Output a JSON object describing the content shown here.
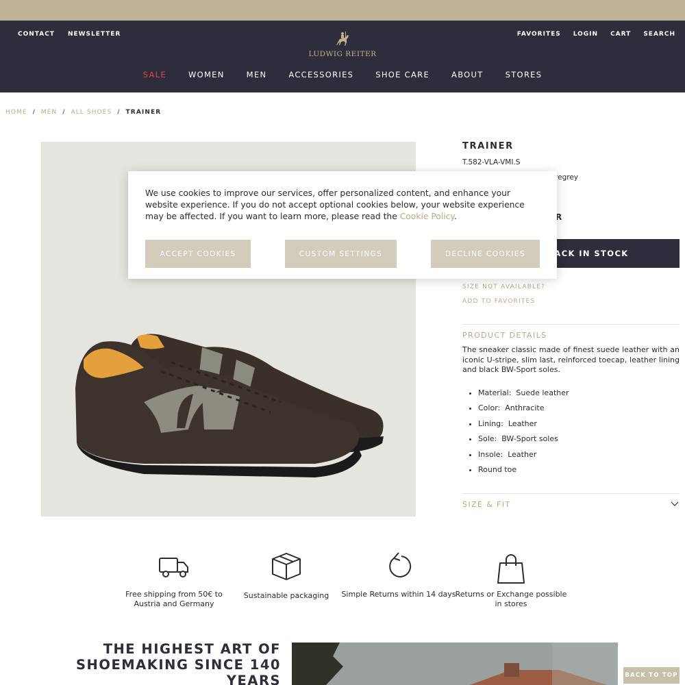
{
  "header": {
    "left_links": [
      "CONTACT",
      "NEWSLETTER"
    ],
    "right_links": [
      "FAVORITES",
      "LOGIN",
      "CART",
      "SEARCH"
    ],
    "logo_text": "LUDWIG REITER",
    "nav": [
      "SALE",
      "WOMEN",
      "MEN",
      "ACCESSORIES",
      "SHOE CARE",
      "ABOUT",
      "STORES"
    ]
  },
  "breadcrumb": {
    "items": [
      "HOME",
      "MEN",
      "ALL SHOES"
    ],
    "current": "TRAINER",
    "separator": "/"
  },
  "product": {
    "title": "TRAINER",
    "sku": "T.582-VLA-VMI.S",
    "color_fragment": "ivegrey",
    "price_fragment": "R",
    "notify_button": "ACK IN STOCK",
    "size_not_available": "SIZE NOT AVAILABLE?",
    "add_to_favorites": "ADD TO FAVORITES",
    "details_title": "PRODUCT DETAILS",
    "description": "The sneaker classic made of finest suede leather with an iconic U-stripe, slim last, reinforced toecap, leather lining and black BW-Sport soles.",
    "details": [
      {
        "label": "Material:",
        "value": "Suede leather"
      },
      {
        "label": "Color:",
        "value": "Anthracite"
      },
      {
        "label": "Lining:",
        "value": "Leather"
      },
      {
        "label": "Sole:",
        "value": "BW-Sport soles"
      },
      {
        "label": "Insole:",
        "value": "Leather"
      },
      {
        "label": "",
        "value": "Round toe"
      }
    ],
    "size_fit_title": "SIZE & FIT"
  },
  "features": [
    {
      "icon": "truck-icon",
      "label": "Free shipping from 50€ to Austria and Germany"
    },
    {
      "icon": "box-icon",
      "label": "Sustainable packaging"
    },
    {
      "icon": "return-arrow-icon",
      "label": "Simple Returns within 14 days"
    },
    {
      "icon": "shopping-bag-icon",
      "label": "Returns or Exchange possible in stores"
    }
  ],
  "heritage": {
    "title_line1": "THE HIGHEST ART OF",
    "title_line2": "SHOEMAKING SINCE 140 YEARS"
  },
  "back_to_top": "BACK TO TOP",
  "cookie": {
    "text": "We use cookies to improve our services, offer personalized content, and enhance your website experience. If you do not accept optional cookies below, your website experience may be affected. If you want to learn more, please read the ",
    "policy_link": "Cookie Policy",
    "text_end": ".",
    "accept": "ACCEPT COOKIES",
    "custom": "CUSTOM SETTINGS",
    "decline": "DECLINE COOKIES"
  },
  "colors": {
    "header_bg": "#2d2d3b",
    "top_strip": "#bfb397",
    "accent_gold": "#bcab86",
    "sale_red": "#e2434a",
    "cookie_button": "#d3ccbb"
  }
}
